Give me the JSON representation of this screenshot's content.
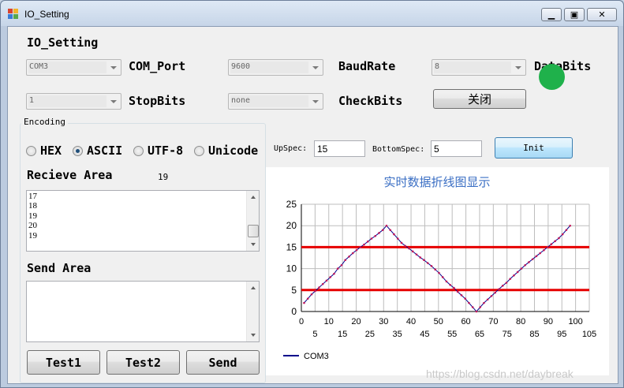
{
  "window": {
    "title": "IO_Setting"
  },
  "header": {
    "section_title": "IO_Setting"
  },
  "serial": {
    "com_port": {
      "value": "COM3",
      "label": "COM_Port"
    },
    "baud_rate": {
      "value": "9600",
      "label": "BaudRate"
    },
    "data_bits": {
      "value": "8",
      "label": "DataBits"
    },
    "stop_bits": {
      "value": "1",
      "label": "StopBits"
    },
    "check_bits": {
      "value": "none",
      "label": "CheckBits"
    },
    "close_button": "关闭",
    "status_color": "#1fb14b"
  },
  "encoding": {
    "title": "Encoding",
    "options": [
      {
        "label": "HEX",
        "selected": false
      },
      {
        "label": "ASCII",
        "selected": true
      },
      {
        "label": "UTF-8",
        "selected": false
      },
      {
        "label": "Unicode",
        "selected": false
      }
    ]
  },
  "receive": {
    "label": "Recieve Area",
    "count": "19",
    "lines": [
      "17",
      "18",
      "19",
      "20",
      "19"
    ]
  },
  "send": {
    "label": "Send Area",
    "text": ""
  },
  "buttons": {
    "test1": "Test1",
    "test2": "Test2",
    "send": "Send",
    "init": "Init"
  },
  "spec": {
    "up_label": "UpSpec:",
    "up_value": "15",
    "bottom_label": "BottomSpec:",
    "bottom_value": "5"
  },
  "watermark": "https://blog.csdn.net/daybreak",
  "chart_data": {
    "type": "line",
    "title": "实时数据折线图显示",
    "series": [
      {
        "name": "COM3",
        "color": "#c2185b",
        "line_color": "#00008b",
        "y": [
          2,
          3,
          4,
          4.8,
          5.6,
          6.4,
          7.2,
          8,
          8.8,
          10,
          10.8,
          12,
          12.8,
          13.6,
          14.3,
          15,
          15.6,
          16.3,
          17,
          17.6,
          18.3,
          19,
          20,
          19,
          18,
          17,
          16,
          15.3,
          14.7,
          14,
          13.3,
          12.6,
          12,
          11.3,
          10.6,
          9.8,
          9,
          8,
          7,
          6.2,
          5.5,
          4.6,
          3.8,
          3,
          2,
          1,
          0,
          1,
          2,
          2.8,
          3.6,
          4.4,
          5.2,
          6,
          6.7,
          7.6,
          8.4,
          9.2,
          10,
          10.8,
          11.5,
          12.2,
          12.9,
          13.6,
          14.3,
          15,
          15.7,
          16.4,
          17.1,
          18,
          19,
          20
        ]
      }
    ],
    "reference_lines": [
      15,
      5
    ],
    "reference_color": "#e60000",
    "x_ticks_upper": [
      0,
      10,
      20,
      30,
      40,
      50,
      60,
      70,
      80,
      90,
      100
    ],
    "x_ticks_lower": [
      5,
      15,
      25,
      35,
      45,
      55,
      65,
      75,
      85,
      95,
      105
    ],
    "y_ticks": [
      0,
      5,
      10,
      15,
      20,
      25
    ],
    "xlim": [
      0,
      105
    ],
    "ylim": [
      0,
      25
    ],
    "grid": true,
    "legend": "bottom-left"
  }
}
